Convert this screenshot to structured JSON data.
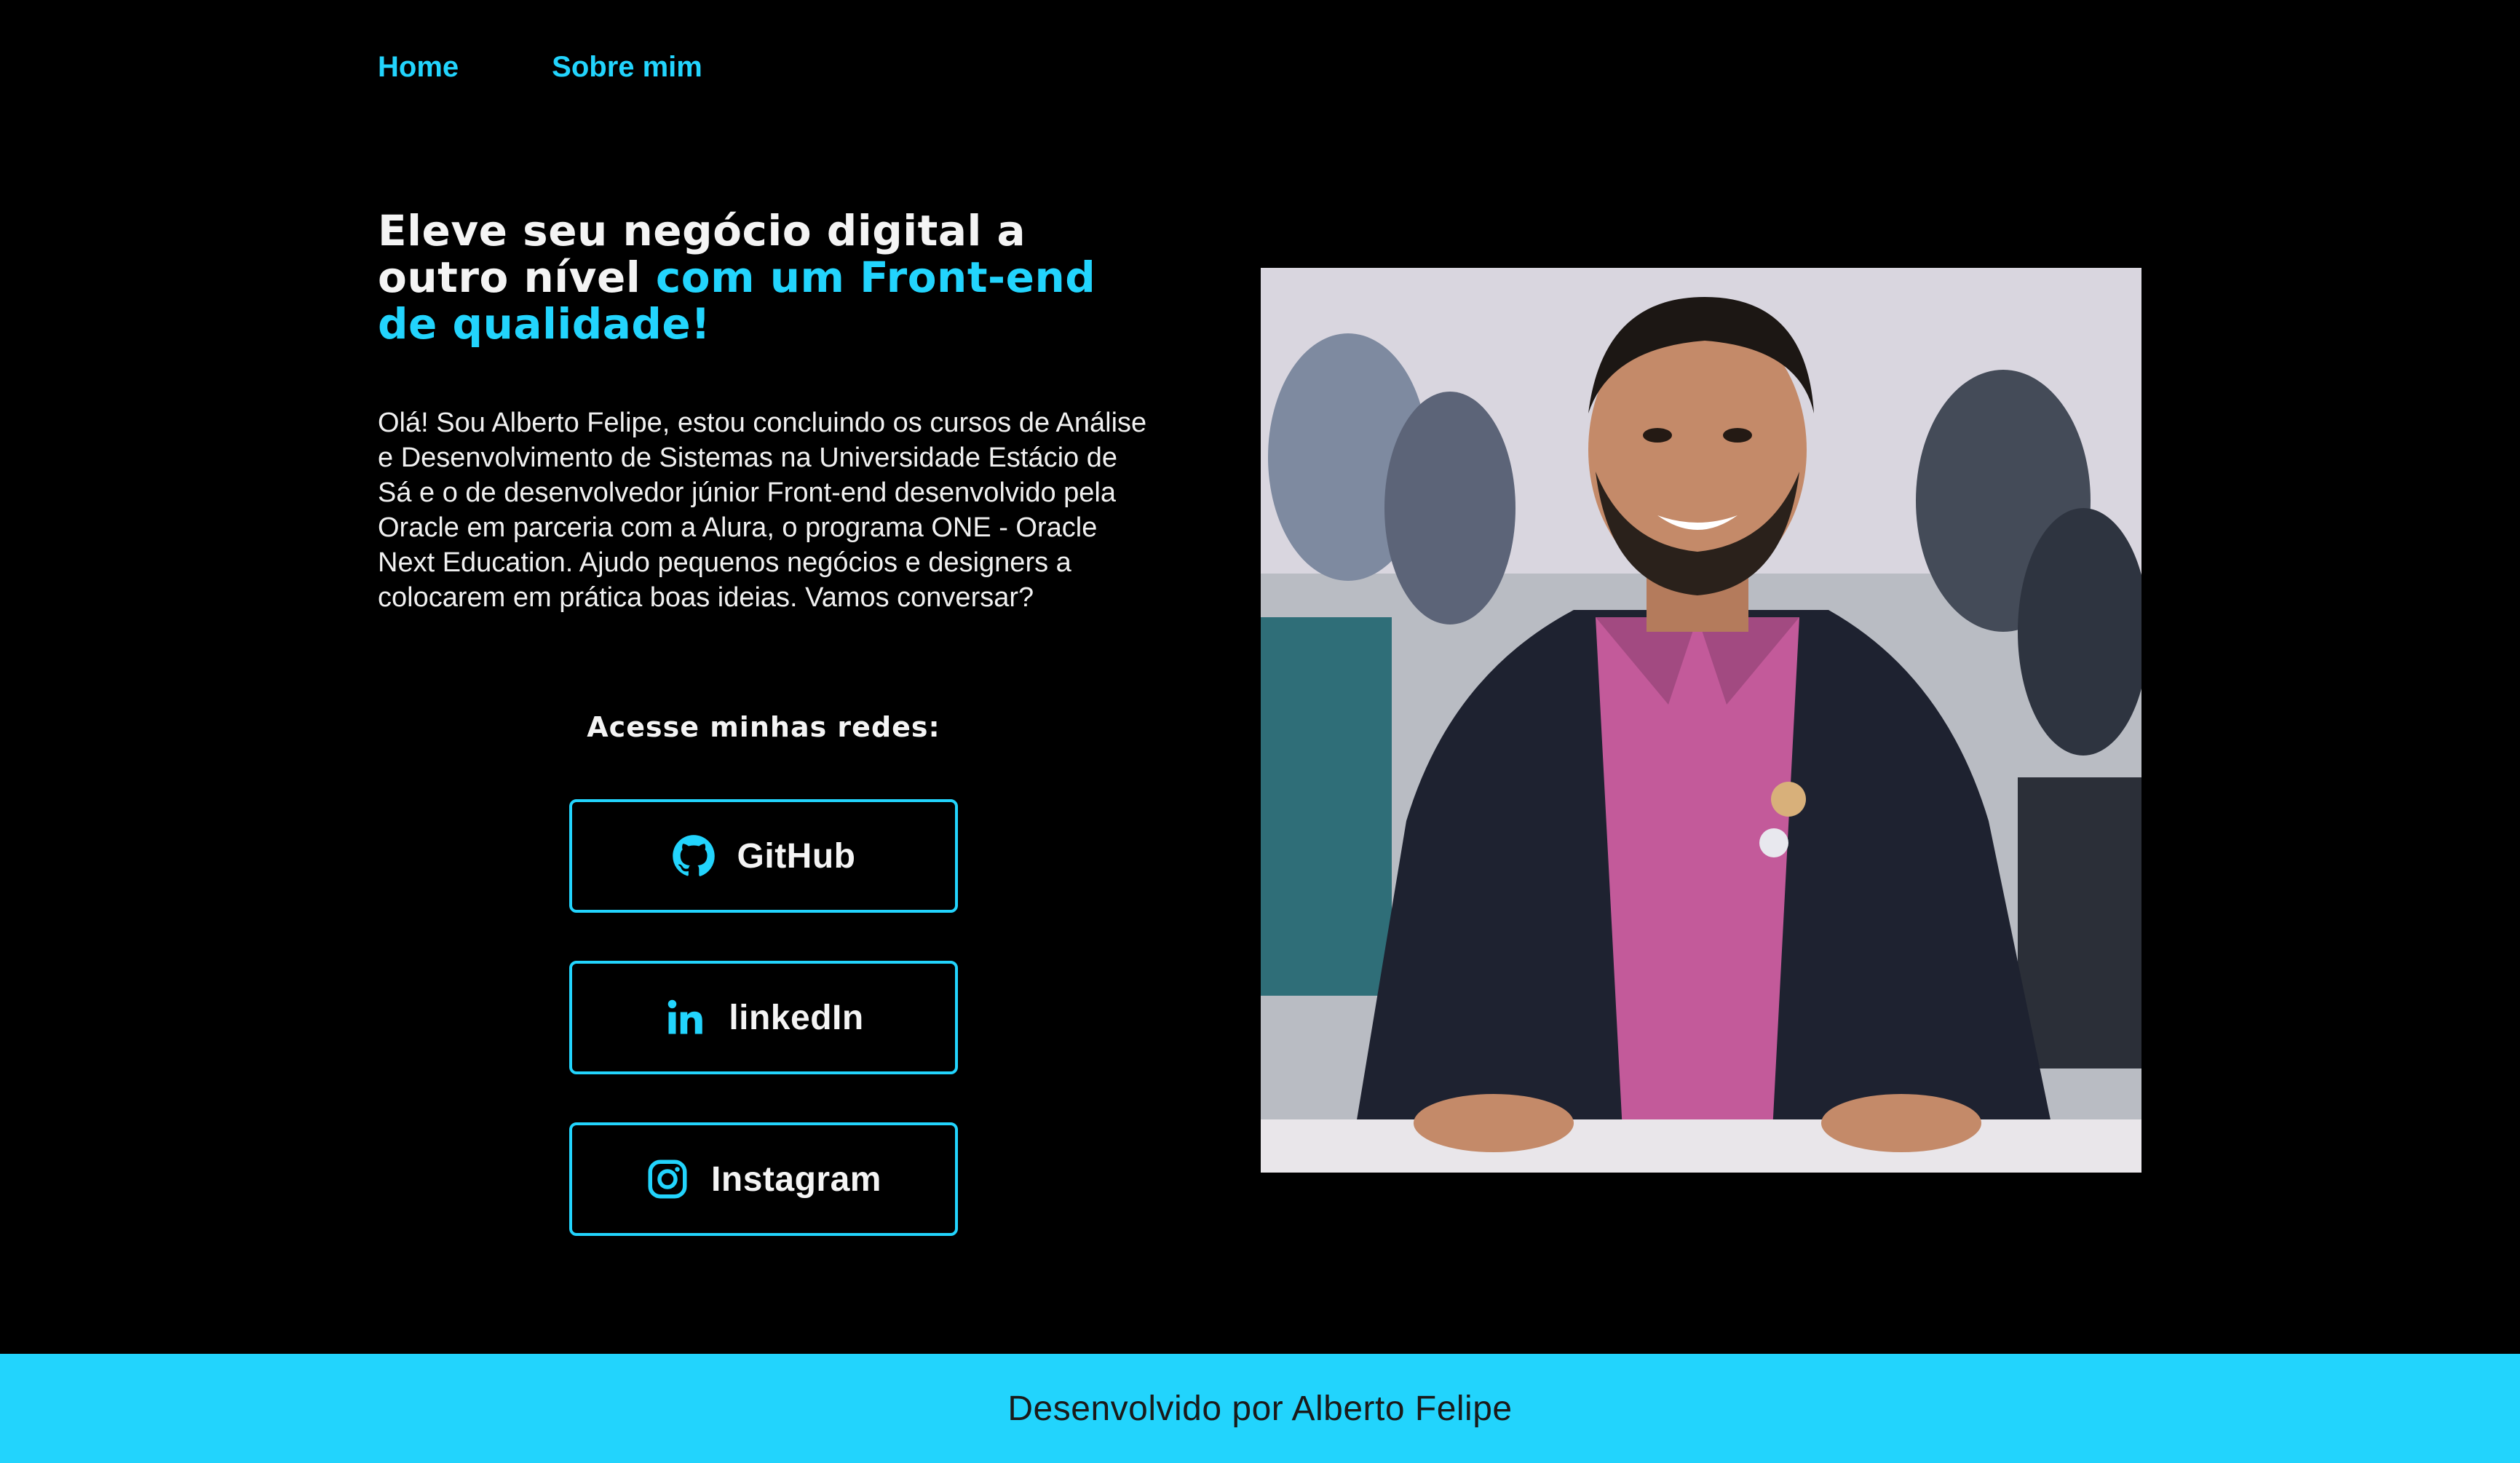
{
  "nav": {
    "home": "Home",
    "about": "Sobre mim"
  },
  "hero": {
    "headline_part1": "Eleve seu negócio digital a outro nível ",
    "headline_accent": "com um Front-end de qualidade!",
    "intro": "Olá! Sou Alberto Felipe, estou concluindo os cursos de Análise e Desenvolvimento de Sistemas na Universidade Estácio de Sá e o de desenvolvedor júnior Front-end desenvolvido pela Oracle em parceria com a Alura, o programa ONE - Oracle Next Education. Ajudo pequenos negócios e designers a colocarem em prática boas ideias. Vamos conversar?"
  },
  "socials": {
    "title": "Acesse minhas redes:",
    "items": [
      {
        "label": "GitHub",
        "icon": "github-icon"
      },
      {
        "label": "linkedIn",
        "icon": "linkedin-icon"
      },
      {
        "label": "Instagram",
        "icon": "instagram-icon"
      }
    ]
  },
  "photo": {
    "alt": "profile-photo"
  },
  "footer": {
    "text": "Desenvolvido por Alberto Felipe"
  },
  "colors": {
    "background": "#000000",
    "accent": "#22D4FD",
    "text": "#F4F4F4"
  }
}
